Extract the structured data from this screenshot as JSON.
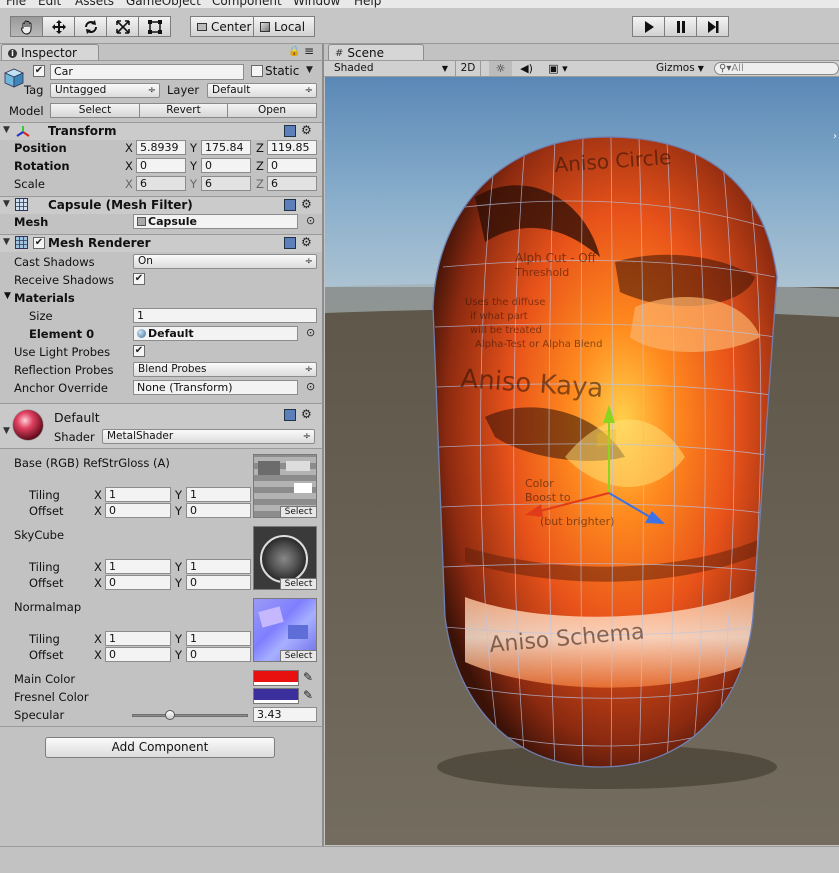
{
  "menubar": {
    "items": [
      "File",
      "Edit",
      "Assets",
      "GameObject",
      "Component",
      "Window",
      "Help"
    ]
  },
  "toolbar": {
    "center_label": "Center",
    "local_label": "Local"
  },
  "inspector": {
    "tab_label": "Inspector",
    "object_name": "Car",
    "static_label": "Static",
    "tag_label": "Tag",
    "tag_value": "Untagged",
    "layer_label": "Layer",
    "layer_value": "Default",
    "model_label": "Model",
    "model_buttons": [
      "Select",
      "Revert",
      "Open"
    ],
    "transform": {
      "title": "Transform",
      "position_label": "Position",
      "rotation_label": "Rotation",
      "scale_label": "Scale",
      "position": {
        "x": "5.8939",
        "y": "175.84",
        "z": "119.85"
      },
      "rotation": {
        "x": "0",
        "y": "0",
        "z": "0"
      },
      "scale": {
        "x": "6",
        "y": "6",
        "z": "6"
      }
    },
    "mesh_filter": {
      "title": "Capsule (Mesh Filter)",
      "mesh_label": "Mesh",
      "mesh_value": "Capsule"
    },
    "mesh_renderer": {
      "title": "Mesh Renderer",
      "cast_shadows_label": "Cast Shadows",
      "cast_shadows_value": "On",
      "receive_shadows_label": "Receive Shadows",
      "materials_label": "Materials",
      "size_label": "Size",
      "size_value": "1",
      "element0_label": "Element 0",
      "element0_value": "Default",
      "light_probes_label": "Use Light Probes",
      "reflection_probes_label": "Reflection Probes",
      "reflection_probes_value": "Blend Probes",
      "anchor_override_label": "Anchor Override",
      "anchor_override_value": "None (Transform)"
    },
    "material": {
      "name": "Default",
      "shader_label": "Shader",
      "shader_value": "MetalShader",
      "base_label": "Base (RGB) RefStrGloss (A)",
      "skycube_label": "SkyCube",
      "normalmap_label": "Normalmap",
      "tiling_label": "Tiling",
      "offset_label": "Offset",
      "select_label": "Select",
      "base_tiling": {
        "x": "1",
        "y": "1"
      },
      "base_offset": {
        "x": "0",
        "y": "0"
      },
      "sky_tiling": {
        "x": "1",
        "y": "1"
      },
      "sky_offset": {
        "x": "0",
        "y": "0"
      },
      "normal_tiling": {
        "x": "1",
        "y": "1"
      },
      "normal_offset": {
        "x": "0",
        "y": "0"
      },
      "main_color_label": "Main Color",
      "main_color": "#e8110f",
      "fresnel_color_label": "Fresnel Color",
      "fresnel_color": "#3b2f9e",
      "specular_label": "Specular",
      "specular_value": "3.43",
      "specular_level": 0.33
    },
    "add_component_label": "Add Component",
    "axis_x": "X",
    "axis_y": "Y",
    "axis_z": "Z"
  },
  "scene": {
    "tab_label": "Scene",
    "shading_mode": "Shaded",
    "mode_2d": "2D",
    "gizmos_label": "Gizmos",
    "search_placeholder": "All",
    "texture_text": [
      "Aniso Circle",
      "Alph Cut - Off",
      "Threshold",
      "Uses the diffuse",
      "if what part",
      "will be treated",
      "Alpha-Test or Alpha Blend",
      "Aniso Kaya",
      "Color",
      "Boost to",
      "(but brighter)",
      "Aniso Schema"
    ]
  }
}
